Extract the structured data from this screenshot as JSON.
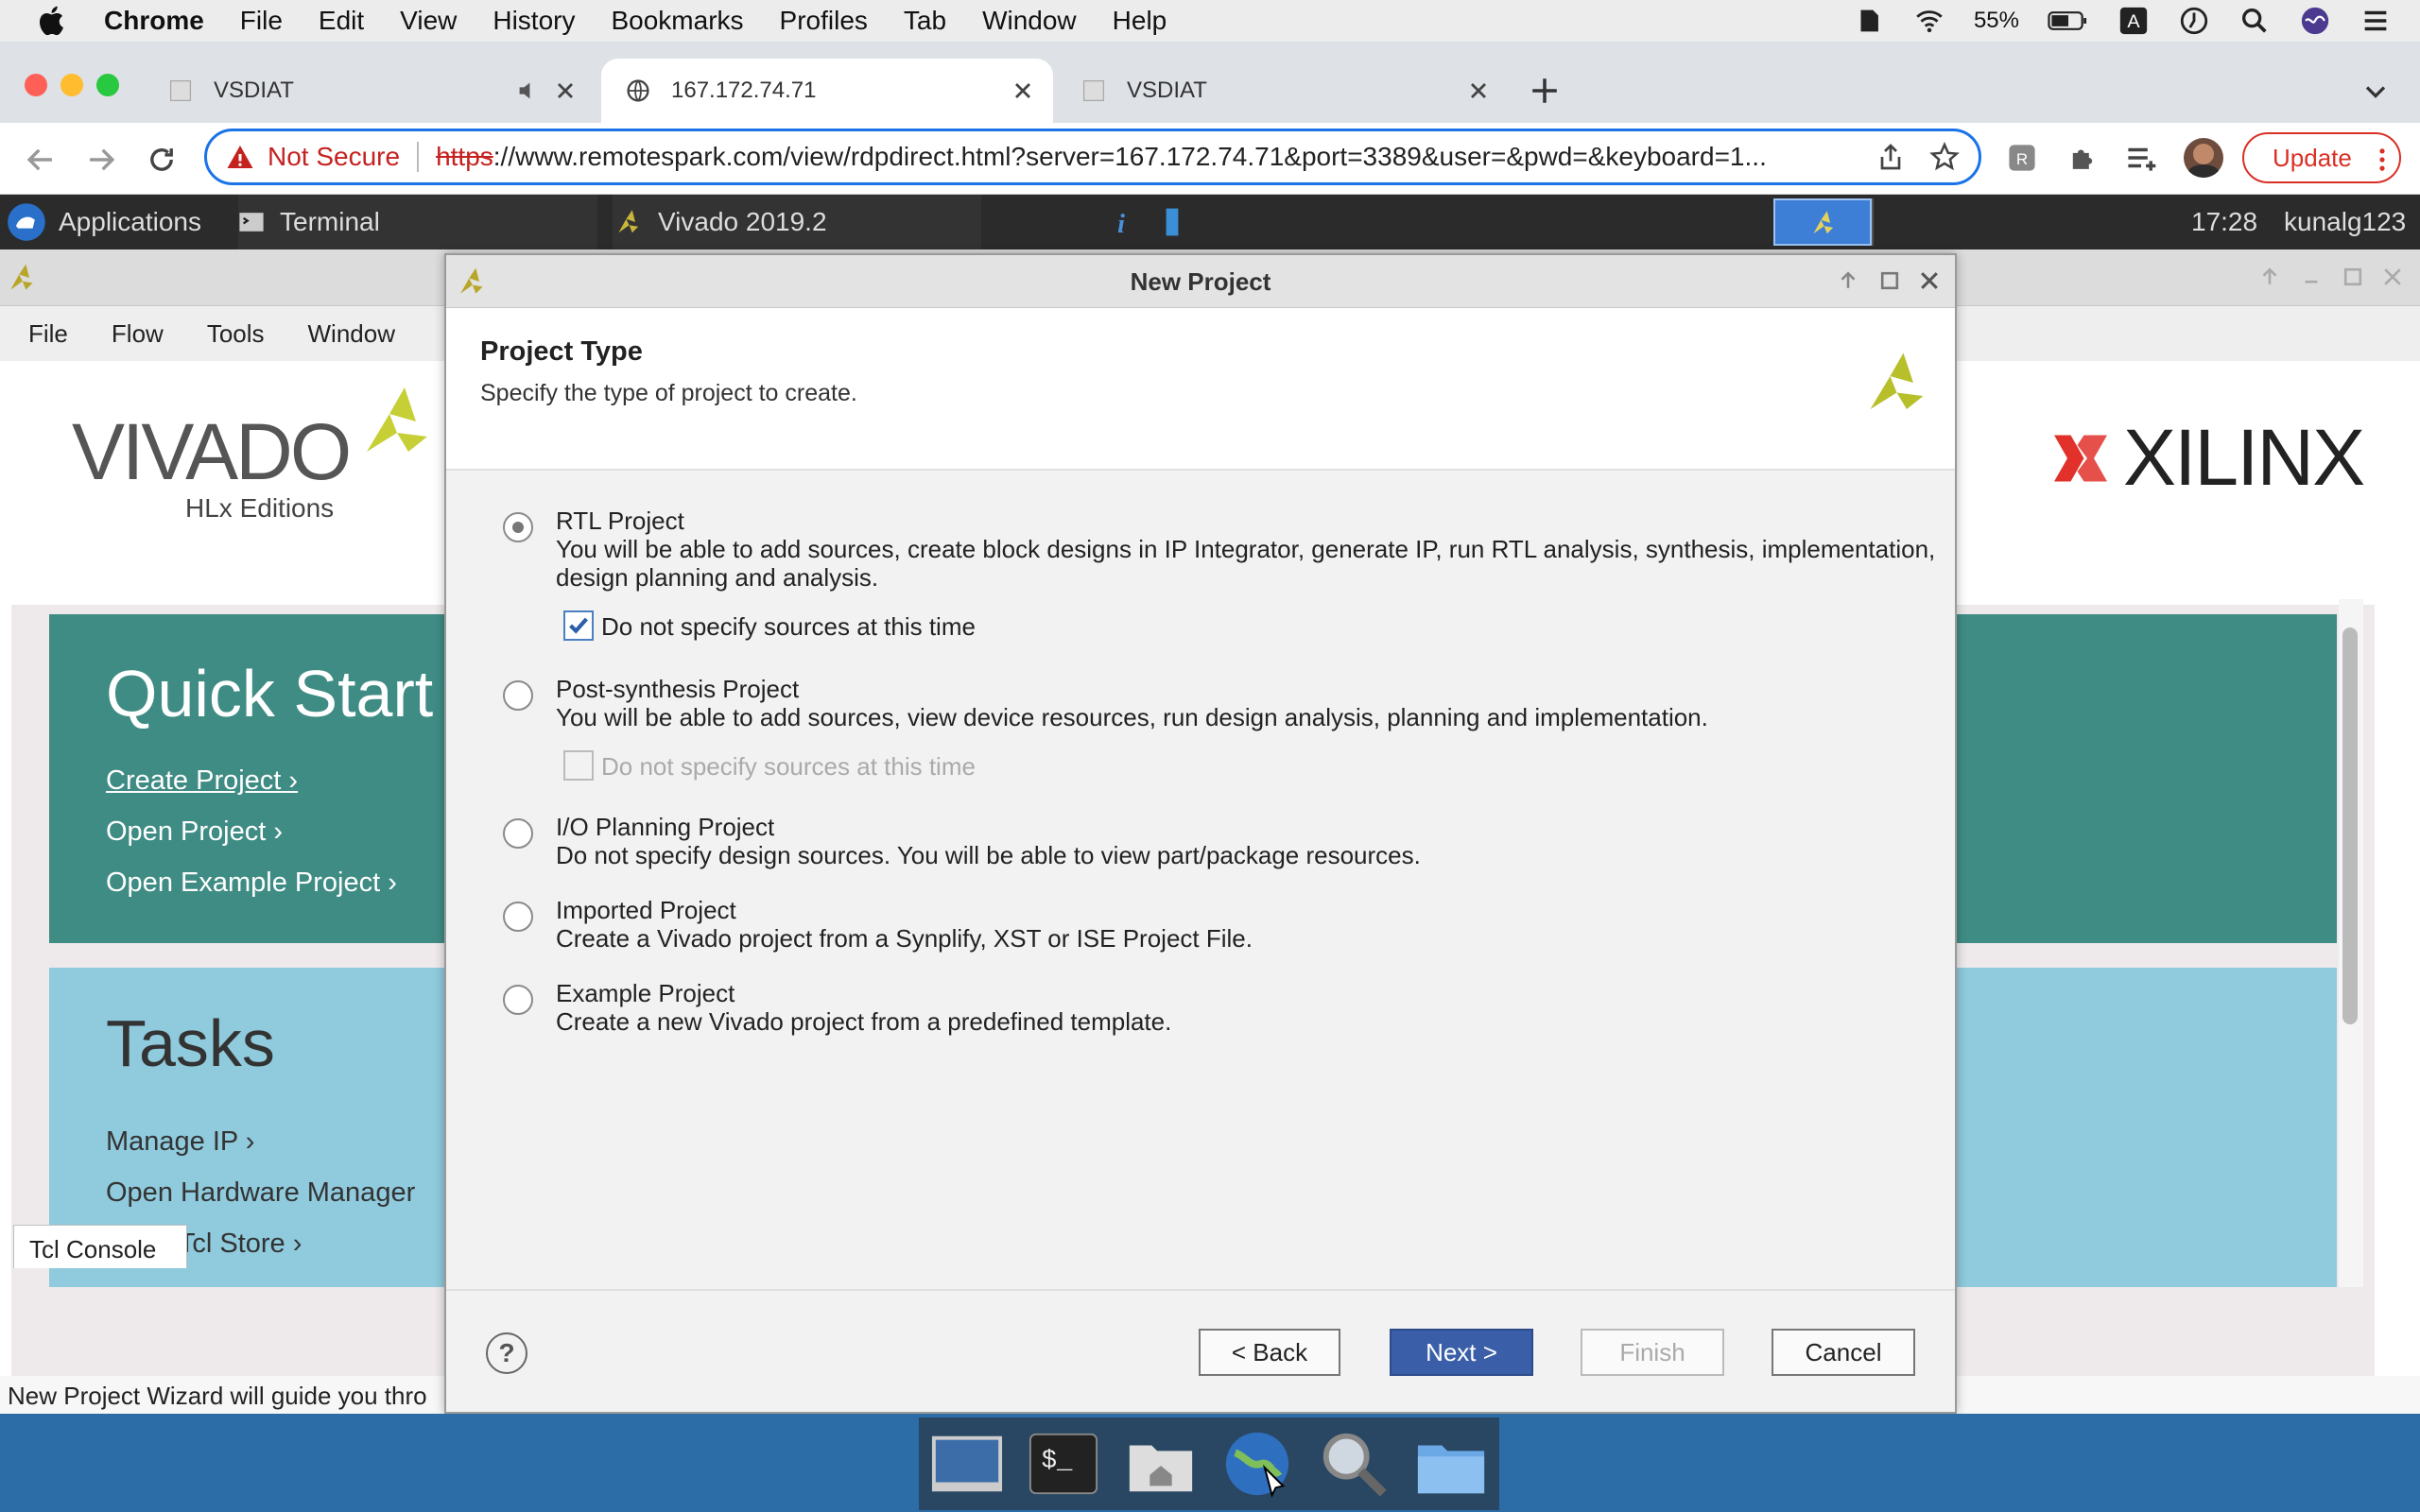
{
  "menubar": {
    "app_name": "Chrome",
    "items": [
      "File",
      "Edit",
      "View",
      "History",
      "Bookmarks",
      "Profiles",
      "Tab",
      "Window",
      "Help"
    ],
    "battery": "55%"
  },
  "browser": {
    "tabs": [
      {
        "title": "VSDIAT",
        "active": false
      },
      {
        "title": "167.172.74.71",
        "active": true
      },
      {
        "title": "VSDIAT",
        "active": false
      }
    ],
    "not_secure": "Not Secure",
    "url_scheme": "https",
    "url_rest": "://www.remotespark.com/view/rdpdirect.html?server=167.172.74.71&port=3389&user=&pwd=&keyboard=1...",
    "update_label": "Update"
  },
  "remote_panel": {
    "applications": "Applications",
    "terminal": "Terminal",
    "vivado_task": "Vivado 2019.2",
    "time": "17:28",
    "user": "kunalg123"
  },
  "vivado": {
    "menu": [
      "File",
      "Flow",
      "Tools",
      "Window"
    ],
    "logo": "VIVADO",
    "logo_sub": "HLx Editions",
    "xilinx": "XILINX",
    "quick_start": {
      "heading": "Quick Start",
      "links": [
        "Create Project",
        "Open Project",
        "Open Example Project"
      ]
    },
    "tasks": {
      "heading": "Tasks",
      "links": [
        "Manage IP",
        "Open Hardware Manager",
        "Xilinx Tcl Store"
      ]
    },
    "tcl_tab": "Tcl Console",
    "status": "New Project Wizard will guide you thro"
  },
  "dialog": {
    "title": "New Project",
    "heading": "Project Type",
    "subheading": "Specify the type of project to create.",
    "options": [
      {
        "title": "RTL Project",
        "desc": "You will be able to add sources, create block designs in IP Integrator, generate IP, run RTL analysis, synthesis, implementation, design planning and analysis.",
        "selected": true
      },
      {
        "title": "Post-synthesis Project",
        "desc": "You will be able to add sources, view device resources, run design analysis, planning and implementation.",
        "selected": false
      },
      {
        "title": "I/O Planning Project",
        "desc": "Do not specify design sources. You will be able to view part/package resources.",
        "selected": false
      },
      {
        "title": "Imported Project",
        "desc": "Create a Vivado project from a Synplify, XST or ISE Project File.",
        "selected": false
      },
      {
        "title": "Example Project",
        "desc": "Create a new Vivado project from a predefined template.",
        "selected": false
      }
    ],
    "rtl_checkbox": {
      "label": "Do not specify sources at this time",
      "checked": true
    },
    "post_checkbox": {
      "label": "Do not specify sources at this time",
      "checked": false,
      "disabled": true
    },
    "buttons": {
      "help": "?",
      "back": "< Back",
      "next": "Next >",
      "finish": "Finish",
      "cancel": "Cancel"
    }
  }
}
